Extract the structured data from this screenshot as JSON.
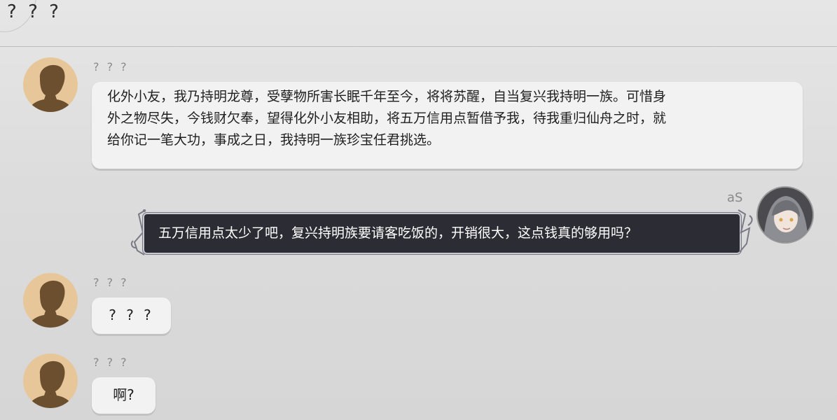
{
  "header": {
    "title": "? ? ?"
  },
  "messages": [
    {
      "sender": "? ? ?",
      "lines": [
        "化外小友，我乃持明龙尊，受孽物所害长眠千年至今，将将苏醒，自当复兴我持明一族。可惜身",
        "外之物尽失，今钱财欠奉，望得化外小友相助，将五万信用点暂借予我，待我重归仙舟之时，就",
        "给你记一笔大功，事成之日，我持明一族珍宝任君挑选。"
      ]
    },
    {
      "sender": "aS",
      "text": "五万信用点太少了吧，复兴持明族要请客吃饭的，开销很大，这点钱真的够用吗？"
    },
    {
      "sender": "? ? ?",
      "text": "? ? ?"
    },
    {
      "sender": "? ? ?",
      "text": "啊?"
    }
  ]
}
